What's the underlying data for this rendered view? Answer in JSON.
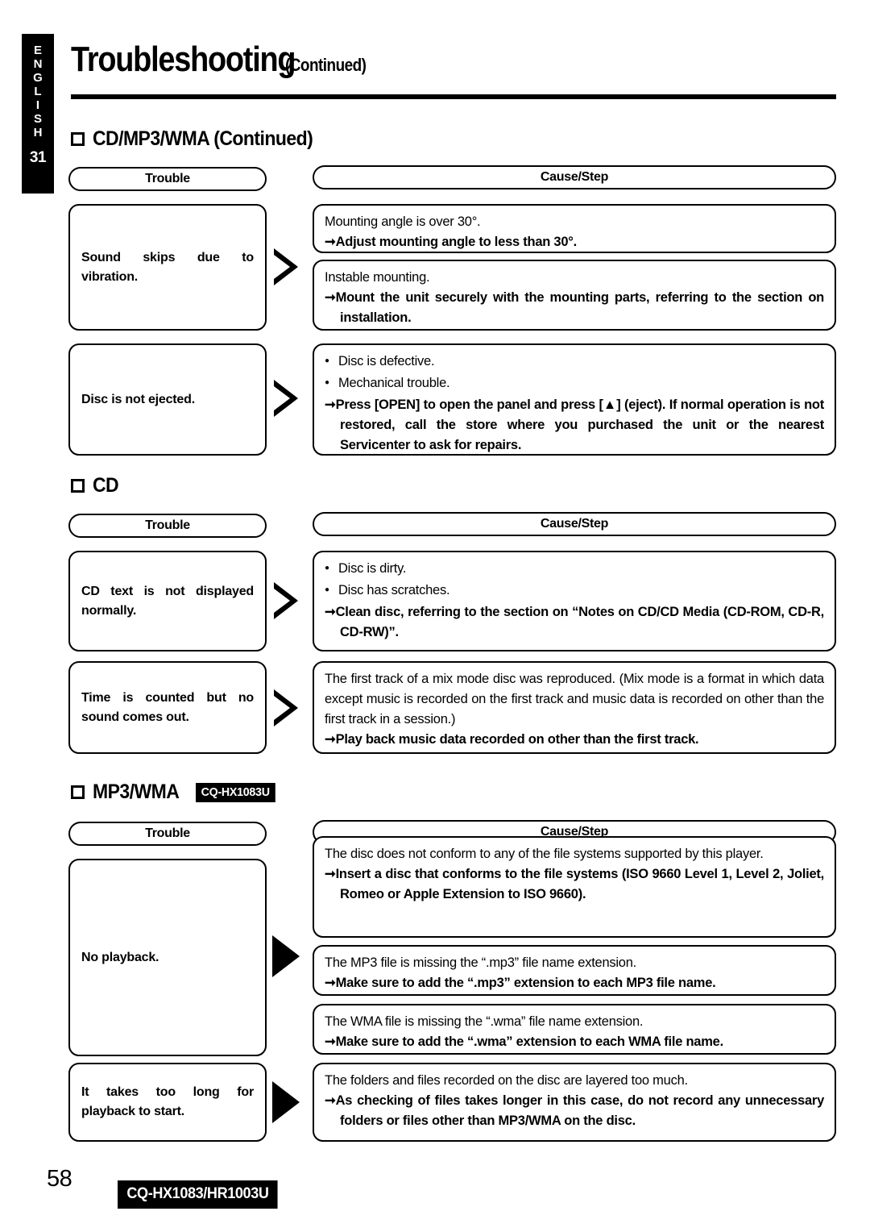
{
  "sidebar": {
    "language_letters": [
      "E",
      "N",
      "G",
      "L",
      "I",
      "S",
      "H"
    ],
    "chapter_number": "31"
  },
  "header": {
    "title": "Troubleshooting",
    "title_suffix": "(Continued)"
  },
  "sections": [
    {
      "heading": "CD/MP3/WMA (Continued)",
      "badge": "",
      "columns": {
        "trouble": "Trouble",
        "cause": "Cause/Step"
      },
      "rows": [
        {
          "trouble": "Sound skips due to vibration.",
          "arrow": "hollow",
          "causes": [
            {
              "lines": [
                {
                  "text": "Mounting angle is over 30°.",
                  "style": "plain"
                },
                {
                  "text": "Adjust mounting angle to less than 30°.",
                  "style": "arrow"
                }
              ]
            },
            {
              "lines": [
                {
                  "text": "Instable mounting.",
                  "style": "plain"
                },
                {
                  "text": "Mount the unit securely with the mounting parts, referring to the section on installation.",
                  "style": "arrow-just"
                }
              ]
            }
          ]
        },
        {
          "trouble": "Disc is not ejected.",
          "arrow": "hollow",
          "causes": [
            {
              "lines": [
                {
                  "text": "Disc is defective.",
                  "style": "bullet"
                },
                {
                  "text": "Mechanical trouble.",
                  "style": "bullet"
                },
                {
                  "text": "Press [OPEN] to open the panel and press [▲] (eject). If normal operation is not restored, call the store where you purchased the unit or the nearest Servicenter to ask for repairs.",
                  "style": "arrow-just"
                }
              ]
            }
          ]
        }
      ]
    },
    {
      "heading": "CD",
      "badge": "",
      "columns": {
        "trouble": "Trouble",
        "cause": "Cause/Step"
      },
      "rows": [
        {
          "trouble": "CD text is not displayed normally.",
          "arrow": "hollow",
          "causes": [
            {
              "lines": [
                {
                  "text": "Disc is dirty.",
                  "style": "bullet"
                },
                {
                  "text": "Disc has scratches.",
                  "style": "bullet"
                },
                {
                  "text": "Clean disc, referring to the section on “Notes on CD/CD Media (CD-ROM, CD-R, CD-RW)”.",
                  "style": "arrow-just"
                }
              ]
            }
          ]
        },
        {
          "trouble": "Time is counted but no sound comes out.",
          "arrow": "hollow",
          "causes": [
            {
              "lines": [
                {
                  "text": "The first track of a mix mode disc was reproduced. (Mix mode is a format in which data except music is recorded on the first track and music data is recorded on other than the first track in a session.)",
                  "style": "plain-just"
                },
                {
                  "text": "Play back music data recorded on other than the first track.",
                  "style": "arrow"
                }
              ]
            }
          ]
        }
      ]
    },
    {
      "heading": "MP3/WMA",
      "badge": "CQ-HX1083U",
      "columns": {
        "trouble": "Trouble",
        "cause": "Cause/Step"
      },
      "rows": [
        {
          "trouble": "No playback.",
          "arrow": "solid",
          "causes": [
            {
              "lines": [
                {
                  "text": "The disc does not conform to any of the file systems supported by this player.",
                  "style": "plain"
                },
                {
                  "text": "Insert a disc that conforms to the file systems (ISO 9660 Level 1, Level 2, Joliet, Romeo or Apple Extension to ISO 9660).",
                  "style": "arrow-just"
                }
              ]
            },
            {
              "lines": [
                {
                  "text": "The MP3 file is missing the “.mp3” file name extension.",
                  "style": "plain"
                },
                {
                  "text": "Make sure to add the “.mp3” extension to each MP3 file name.",
                  "style": "arrow"
                }
              ]
            },
            {
              "lines": [
                {
                  "text": "The WMA file is missing the “.wma” file name extension.",
                  "style": "plain"
                },
                {
                  "text": "Make sure to add the “.wma” extension to each WMA file name.",
                  "style": "arrow"
                }
              ]
            }
          ]
        },
        {
          "trouble": "It takes too long for playback to start.",
          "arrow": "solid",
          "causes": [
            {
              "lines": [
                {
                  "text": "The folders and files recorded on the disc are layered too much.",
                  "style": "plain"
                },
                {
                  "text": "As checking of files takes longer in this case, do not record any unnecessary folders or files other than MP3/WMA on the disc.",
                  "style": "arrow-just"
                }
              ]
            }
          ]
        }
      ]
    }
  ],
  "footer": {
    "page_number": "58",
    "model": "CQ-HX1083/HR1003U"
  },
  "colors": {
    "ink": "#000000",
    "paper": "#ffffff"
  }
}
